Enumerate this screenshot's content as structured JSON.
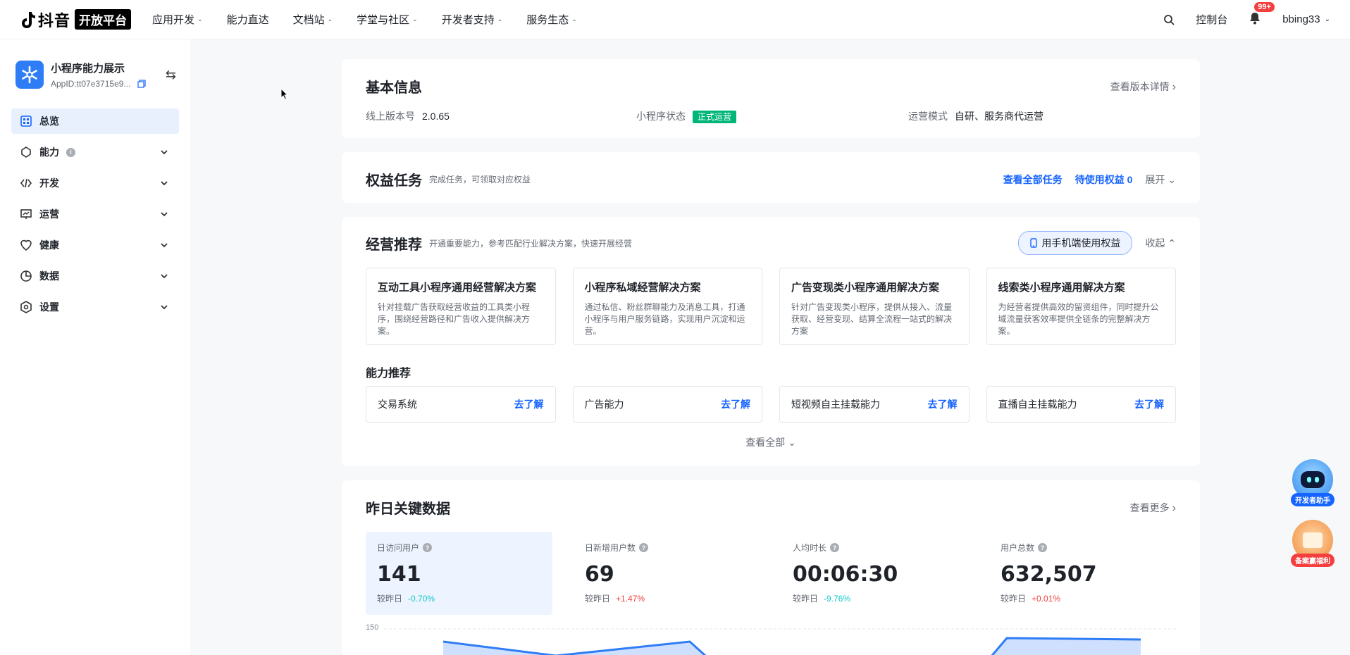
{
  "topnav": {
    "logo_text": "抖音",
    "logo_badge": "开放平台",
    "items": [
      "应用开发",
      "能力直达",
      "文档站",
      "学堂与社区",
      "开发者支持",
      "服务生态"
    ],
    "console": "控制台",
    "bell_badge": "99+",
    "username": "bbing33"
  },
  "sidebar": {
    "app_name": "小程序能力展示",
    "app_id": "AppID:tt07e3715e9...",
    "menu": [
      {
        "label": "总览",
        "icon": "overview-icon"
      },
      {
        "label": "能力",
        "icon": "capability-icon"
      },
      {
        "label": "开发",
        "icon": "code-icon"
      },
      {
        "label": "运营",
        "icon": "operations-icon"
      },
      {
        "label": "健康",
        "icon": "health-icon"
      },
      {
        "label": "数据",
        "icon": "data-icon"
      },
      {
        "label": "设置",
        "icon": "settings-icon"
      }
    ]
  },
  "basic": {
    "title": "基本信息",
    "link": "查看版本详情",
    "version_label": "线上版本号",
    "version": "2.0.65",
    "status_label": "小程序状态",
    "status": "正式运营",
    "mode_label": "运营模式",
    "mode": "自研、服务商代运营"
  },
  "tasks": {
    "title": "权益任务",
    "sub": "完成任务，可领取对应权益",
    "view_all": "查看全部任务",
    "pending": "待使用权益 0",
    "expand": "展开"
  },
  "business": {
    "title": "经营推荐",
    "sub": "开通重要能力，参考匹配行业解决方案，快速开展经营",
    "phone_btn": "用手机端使用权益",
    "collapse": "收起",
    "solutions": [
      {
        "title": "互动工具小程序通用经营解决方案",
        "desc": "针对挂载广告获取经营收益的工具类小程序，围绕经营路径和广告收入提供解决方案。"
      },
      {
        "title": "小程序私域经营解决方案",
        "desc": "通过私信、粉丝群聊能力及消息工具，打通小程序与用户服务链路，实现用户沉淀和运营。"
      },
      {
        "title": "广告变现类小程序通用解决方案",
        "desc": "针对广告变现类小程序，提供从接入、流量获取、经营变现、结算全流程一站式的解决方案"
      },
      {
        "title": "线索类小程序通用解决方案",
        "desc": "为经营者提供高效的留资组件，同时提升公域流量获客效率提供全链条的完整解决方案。"
      }
    ],
    "cap_heading": "能力推荐",
    "capabilities": [
      {
        "label": "交易系统",
        "link": "去了解"
      },
      {
        "label": "广告能力",
        "link": "去了解"
      },
      {
        "label": "短视频自主挂载能力",
        "link": "去了解"
      },
      {
        "label": "直播自主挂载能力",
        "link": "去了解"
      }
    ],
    "view_all": "查看全部"
  },
  "keydata": {
    "title": "昨日关键数据",
    "more": "查看更多",
    "cmp_label": "较昨日",
    "kpis": [
      {
        "label": "日访问用户",
        "value": "141",
        "change": "-0.70%",
        "dir": "down"
      },
      {
        "label": "日新增用户数",
        "value": "69",
        "change": "+1.47%",
        "dir": "up"
      },
      {
        "label": "人均时长",
        "value": "00:06:30",
        "change": "-9.76%",
        "dir": "down"
      },
      {
        "label": "用户总数",
        "value": "632,507",
        "change": "+0.01%",
        "dir": "up"
      }
    ],
    "chart_tick": "150"
  },
  "floats": {
    "assistant": "开发者助手",
    "welfare": "备案赢福利"
  },
  "colors": {
    "accent": "#1664ff",
    "status": "#00b578",
    "down": "#14c9c9",
    "up": "#f53f3f"
  }
}
